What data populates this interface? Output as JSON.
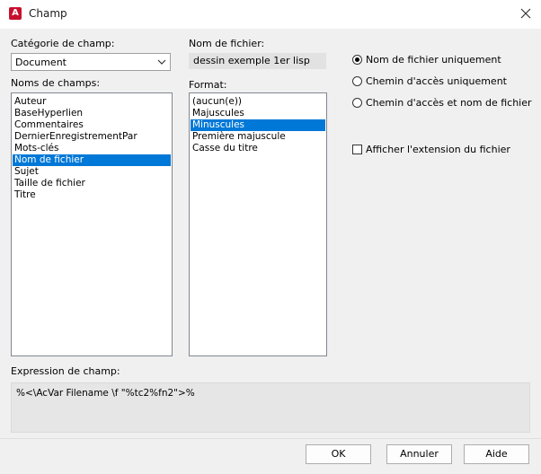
{
  "window": {
    "title": "Champ",
    "app_icon_letter": "A"
  },
  "category": {
    "label": "Catégorie de champ:",
    "value": "Document"
  },
  "field_names": {
    "label": "Noms de champs:",
    "items": [
      "Auteur",
      "BaseHyperlien",
      "Commentaires",
      "DernierEnregistrementPar",
      "Mots-clés",
      "Nom de fichier",
      "Sujet",
      "Taille de fichier",
      "Titre"
    ],
    "selected": "Nom de fichier"
  },
  "filename": {
    "label": "Nom de fichier:",
    "value": "dessin exemple 1er lisp"
  },
  "format": {
    "label": "Format:",
    "items": [
      "(aucun(e))",
      "Majuscules",
      "Minuscules",
      "Première majuscule",
      "Casse du titre"
    ],
    "selected": "Minuscules"
  },
  "options": {
    "radios": [
      "Nom de fichier uniquement",
      "Chemin d'accès uniquement",
      "Chemin d'accès et nom de fichier"
    ],
    "selected_radio": "Nom de fichier uniquement",
    "checkbox_label": "Afficher l'extension du fichier",
    "checkbox_checked": false
  },
  "expression": {
    "label": "Expression de champ:",
    "value": "%<\\AcVar Filename \\f \"%tc2%fn2\">%"
  },
  "buttons": {
    "ok": "OK",
    "cancel": "Annuler",
    "help": "Aide"
  },
  "colors": {
    "selection": "#0078d7",
    "app_icon": "#c8102e"
  }
}
